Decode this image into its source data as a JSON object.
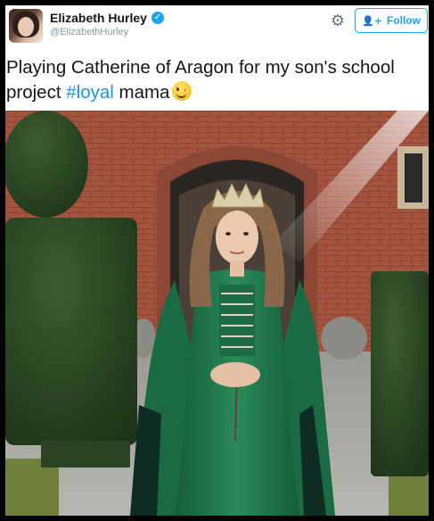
{
  "user": {
    "display_name": "Elizabeth Hurley",
    "handle": "@ElizabethHurley",
    "verified_icon": "verified-badge-icon",
    "avatar_icon": "profile-avatar"
  },
  "header": {
    "settings_icon": "gear-icon",
    "follow_label": "Follow",
    "follow_icon": "add-user-icon"
  },
  "tweet": {
    "text_before": "Playing Catherine of Aragon for my son's school project ",
    "hashtag": "#loyal",
    "text_after": " mama",
    "emoji": "winking-face-emoji"
  },
  "colors": {
    "accent": "#1da1f2",
    "hashtag": "#1b95e0",
    "dress": "#1f7a4e",
    "brick": "#a0523e"
  }
}
